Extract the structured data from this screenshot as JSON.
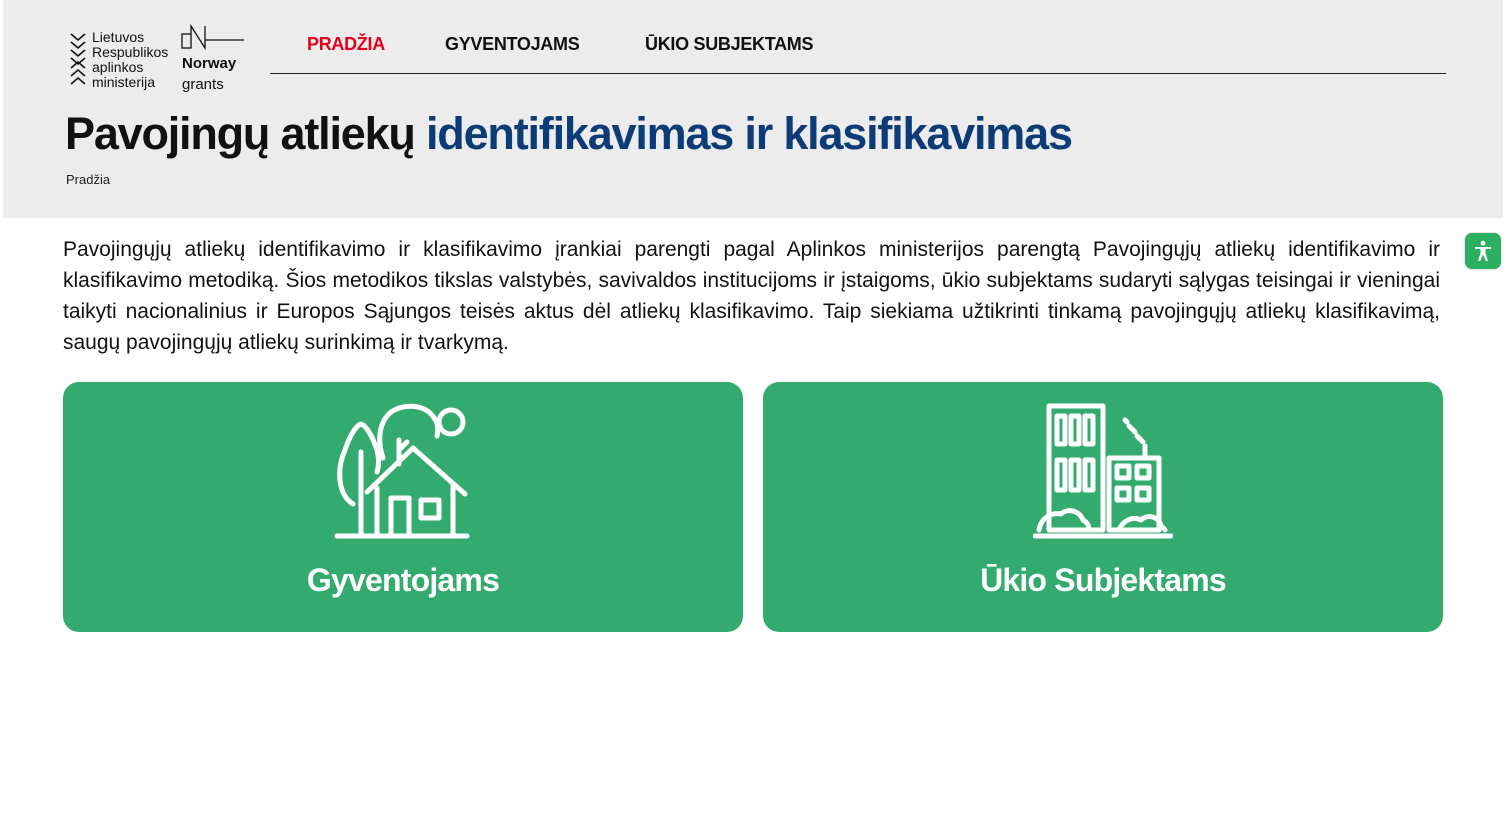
{
  "header": {
    "ministry_logo_lines": [
      "Lietuvos",
      "Respublikos",
      "aplinkos",
      "ministerija"
    ],
    "norway_logo": {
      "word": "Norway",
      "sub": "grants"
    }
  },
  "nav": {
    "items": [
      {
        "label": "PRADŽIA",
        "active": true
      },
      {
        "label": "GYVENTOJAMS",
        "active": false
      },
      {
        "label": "ŪKIO SUBJEKTAMS",
        "active": false
      }
    ],
    "active_color": "#e4001b"
  },
  "page": {
    "title_main": "Pavojingų atliekų ",
    "title_accent": "identifikavimas ir klasifikavimas",
    "title_accent_color": "#0c3c78",
    "breadcrumb": "Pradžia"
  },
  "intro": {
    "text": "Pavojingųjų atliekų identifikavimo ir klasifikavimo įrankiai parengti pagal Aplinkos ministerijos parengtą Pavojingųjų atliekų identifikavimo ir klasifikavimo metodiką. Šios metodikos tikslas valstybės, savivaldos institucijoms ir įstaigoms, ūkio subjektams sudaryti sąlygas teisingai ir vieningai taikyti nacionalinius ir Europos Sąjungos teisės aktus dėl atliekų klasifikavimo. Taip siekiama užtikrinti tinkamą pavojingųjų atliekų klasifikavimą, saugų pavojingųjų atliekų surinkimą ir tvarkymą."
  },
  "cards": [
    {
      "label": "Gyventojams",
      "icon": "house-with-trees-icon"
    },
    {
      "label": "Ūkio Subjektams",
      "icon": "factory-buildings-icon"
    }
  ],
  "colors": {
    "header_bg": "#ececec",
    "card_green": "#33ab6e",
    "accessibility_green": "#2bb061"
  },
  "accessibility": {
    "icon": "accessibility-person-icon"
  }
}
